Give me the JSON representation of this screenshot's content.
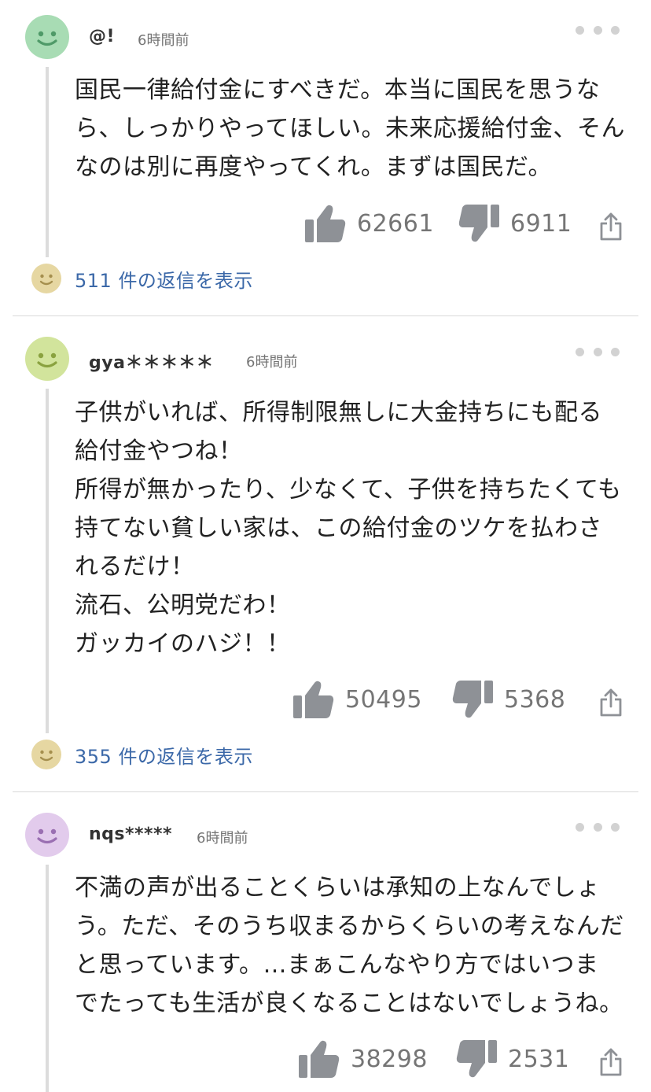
{
  "comments": [
    {
      "username": "@!",
      "time": "6時間前",
      "avatar_color": "#a8dcb4",
      "text": "国民一律給付金にすべきだ。本当に国民を思うな\nら、しっかりやってほしい。未来応援給付金、そん\nなのは別に再度やってくれ。まずは国民だ。",
      "likes": "62661",
      "dislikes": "6911",
      "replies": "511 件の返信を表示"
    },
    {
      "username": "gya＊＊＊＊＊",
      "time": "6時間前",
      "avatar_color": "#d2e49c",
      "text": "子供がいれば、所得制限無しに大金持ちにも配る\n給付金やつね！\n所得が無かったり、少なくて、子供を持ちたくても\n持てない貧しい家は、この給付金のツケを払わさ\nれるだけ！\n流石、公明党だわ！\nガッカイのハジ！！",
      "likes": "50495",
      "dislikes": "5368",
      "replies": "355 件の返信を表示"
    },
    {
      "username": "nqs*****",
      "time": "6時間前",
      "avatar_color": "#e2cbec",
      "text": "不満の声が出ることくらいは承知の上なんでしょ\nう。ただ、そのうち収まるからくらいの考えなんだ\nと思っています。…まぁこんなやり方ではいつま\nでたっても生活が良くなることはないでしょうね。",
      "likes": "38298",
      "dislikes": "2531"
    }
  ],
  "icons": {
    "like": "thumbs-up-icon",
    "dislike": "thumbs-down-icon",
    "share": "share-icon",
    "more": "more-dots-icon",
    "reply_avatar": "smiley-face-icon"
  },
  "colors": {
    "reply_link": "#3b68a8",
    "count_text": "#757575",
    "icon_gray": "#8e9196",
    "reply_avatar": "#e6d7a2"
  }
}
